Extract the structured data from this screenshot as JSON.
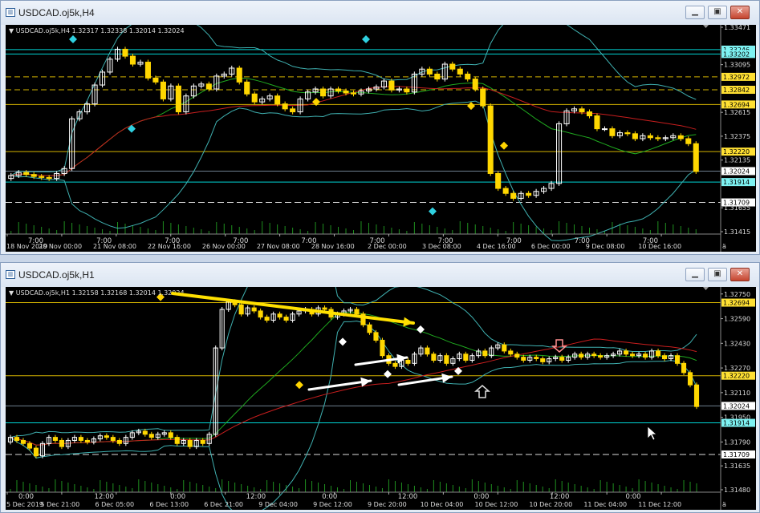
{
  "colors": {
    "bg": "#000000",
    "bull": "#ffffff",
    "bear": "#ffd700",
    "ma_green": "#1fa81f",
    "ma_red": "#c81e1e",
    "band": "#3fb0b0",
    "cyan_line": "#00d5d5",
    "gold_line": "#d4b300",
    "arrow_yellow": "#ffe000",
    "arrow_white": "#ffffff"
  },
  "window_icon": "chart-window-icon",
  "buttons": {
    "minimize": "▁",
    "restore": "▣",
    "close": "✕"
  },
  "top": {
    "title": "USDCAD.oj5k,H4",
    "info": "USDCAD.oj5k,H4  1.32317 1.32338 1.32014 1.32024",
    "price_labels": [
      "1.33471",
      "1.33246",
      "1.33202",
      "1.33095",
      "1.32972",
      "1.32842",
      "1.32694",
      "1.32615",
      "1.32375",
      "1.32220",
      "1.32135",
      "1.32024",
      "1.31914",
      "1.31709",
      "1.31655",
      "1.31415"
    ],
    "date_labels": [
      "18 Nov 2019",
      "20 Nov 00:00",
      "21 Nov 08:00",
      "22 Nov 16:00",
      "26 Nov 00:00",
      "27 Nov 08:00",
      "28 Nov 16:00",
      "2 Dec 00:00",
      "3 Dec 08:00",
      "4 Dec 16:00",
      "6 Dec 00:00",
      "9 Dec 08:00",
      "10 Dec 16:00"
    ],
    "time_marks": [
      "7:00",
      "7:00",
      "7:00",
      "7:00",
      "7:00",
      "7:00",
      "7:00",
      "7:00",
      "7:00",
      "7:00"
    ],
    "corner_label": "ä"
  },
  "bottom": {
    "title": "USDCAD.oj5k,H1",
    "info": "USDCAD.oj5k,H1  1.32158 1.32168 1.32014 1.32024",
    "price_labels": [
      "1.32750",
      "1.32694",
      "1.32590",
      "1.32430",
      "1.32270",
      "1.32220",
      "1.32110",
      "1.32024",
      "1.31950",
      "1.31914",
      "1.31790",
      "1.31709",
      "1.31635",
      "1.31480"
    ],
    "date_labels": [
      "5 Dec 2019",
      "5 Dec 21:00",
      "6 Dec 05:00",
      "6 Dec 13:00",
      "6 Dec 21:00",
      "9 Dec 04:00",
      "9 Dec 12:00",
      "9 Dec 20:00",
      "10 Dec 04:00",
      "10 Dec 12:00",
      "10 Dec 20:00",
      "11 Dec 04:00",
      "11 Dec 12:00"
    ],
    "time_marks": [
      "0:00",
      "12:00",
      "0:00",
      "12:00",
      "0:00",
      "12:00",
      "0:00",
      "12:00",
      "0:00"
    ],
    "corner_label": "ä"
  },
  "chart_data": [
    {
      "type": "candlestick",
      "title": "USDCAD.oj5k,H4",
      "last_close": 1.32024,
      "ylim": [
        1.31415,
        1.33471
      ],
      "levels": {
        "cyan": [
          1.33246,
          1.33202,
          1.31914
        ],
        "gold_dashed": [
          1.32972,
          1.32842
        ],
        "gold_solid": [
          1.32694,
          1.3222
        ],
        "white_dashed": [
          1.31709
        ],
        "white_solid": [
          1.32024
        ]
      },
      "series": [
        {
          "name": "",
          "values": [
            1.3198,
            1.3201,
            1.3199,
            1.3197,
            1.3196,
            1.3195,
            1.32,
            1.3205,
            1.3255,
            1.3262,
            1.327,
            1.3289,
            1.3302,
            1.3315,
            1.3325,
            1.3318,
            1.331,
            1.3312,
            1.3296,
            1.3292,
            1.3275,
            1.3288,
            1.3262,
            1.3278,
            1.3288,
            1.329,
            1.3285,
            1.3298,
            1.33,
            1.3306,
            1.3292,
            1.328,
            1.3272,
            1.3275,
            1.3278,
            1.327,
            1.3265,
            1.3262,
            1.3275,
            1.3282,
            1.3285,
            1.3278,
            1.3285,
            1.3283,
            1.3281,
            1.328,
            1.3283,
            1.3285,
            1.3287,
            1.3293,
            1.3284,
            1.3285,
            1.3282,
            1.33,
            1.3305,
            1.33,
            1.3295,
            1.331,
            1.3305,
            1.33,
            1.3295,
            1.3285,
            1.3268,
            1.32,
            1.3185,
            1.318,
            1.3175,
            1.318,
            1.3178,
            1.3182,
            1.3185,
            1.319,
            1.325,
            1.3263,
            1.3265,
            1.3262,
            1.3258,
            1.3245,
            1.3245,
            1.3238,
            1.3241,
            1.324,
            1.3235,
            1.3238,
            1.3236,
            1.3235,
            1.3236,
            1.3238,
            1.3235,
            1.323,
            1.3202
          ]
        }
      ],
      "markers": {
        "cyan_diamonds": [
          1.3335,
          1.3245,
          1.3335,
          1.3162
        ],
        "yellow_diamonds": [
          1.3272,
          1.3268,
          1.3228
        ]
      }
    },
    {
      "type": "candlestick",
      "title": "USDCAD.oj5k,H1",
      "last_close": 1.32024,
      "ylim": [
        1.3148,
        1.3278
      ],
      "levels": {
        "gold_solid": [
          1.32694,
          1.3222
        ],
        "cyan": [
          1.31914
        ],
        "white_dashed": [
          1.31709
        ],
        "white_solid": [
          1.32024
        ]
      },
      "series": [
        {
          "name": "",
          "values": [
            1.3182,
            1.318,
            1.3178,
            1.3175,
            1.317,
            1.3178,
            1.3182,
            1.318,
            1.3176,
            1.318,
            1.3182,
            1.318,
            1.3179,
            1.3181,
            1.3183,
            1.3182,
            1.318,
            1.3178,
            1.3182,
            1.3185,
            1.3186,
            1.3184,
            1.3182,
            1.3184,
            1.3185,
            1.3182,
            1.3178,
            1.318,
            1.3176,
            1.318,
            1.3178,
            1.3184,
            1.324,
            1.3265,
            1.327,
            1.3268,
            1.3262,
            1.3266,
            1.3264,
            1.326,
            1.3258,
            1.3262,
            1.326,
            1.3258,
            1.3262,
            1.3264,
            1.3265,
            1.3262,
            1.3266,
            1.3265,
            1.326,
            1.3262,
            1.3264,
            1.3265,
            1.3262,
            1.3255,
            1.325,
            1.3245,
            1.3235,
            1.323,
            1.3228,
            1.3232,
            1.323,
            1.3236,
            1.324,
            1.3236,
            1.3232,
            1.3235,
            1.323,
            1.3233,
            1.3236,
            1.3232,
            1.3235,
            1.3238,
            1.3235,
            1.324,
            1.3242,
            1.3238,
            1.3236,
            1.3234,
            1.3232,
            1.3234,
            1.3233,
            1.3231,
            1.3233,
            1.3234,
            1.3232,
            1.3234,
            1.3236,
            1.3234,
            1.3236,
            1.3235,
            1.3234,
            1.3235,
            1.3236,
            1.3238,
            1.3236,
            1.3235,
            1.3236,
            1.3234,
            1.3238,
            1.3235,
            1.3233,
            1.3235,
            1.323,
            1.3224,
            1.3216,
            1.3202
          ]
        }
      ],
      "markers": {
        "yellow_diamonds": [
          1.3273,
          1.3216
        ],
        "white_diamonds": [
          1.3244,
          1.3223,
          1.3252,
          1.3225
        ]
      }
    }
  ]
}
